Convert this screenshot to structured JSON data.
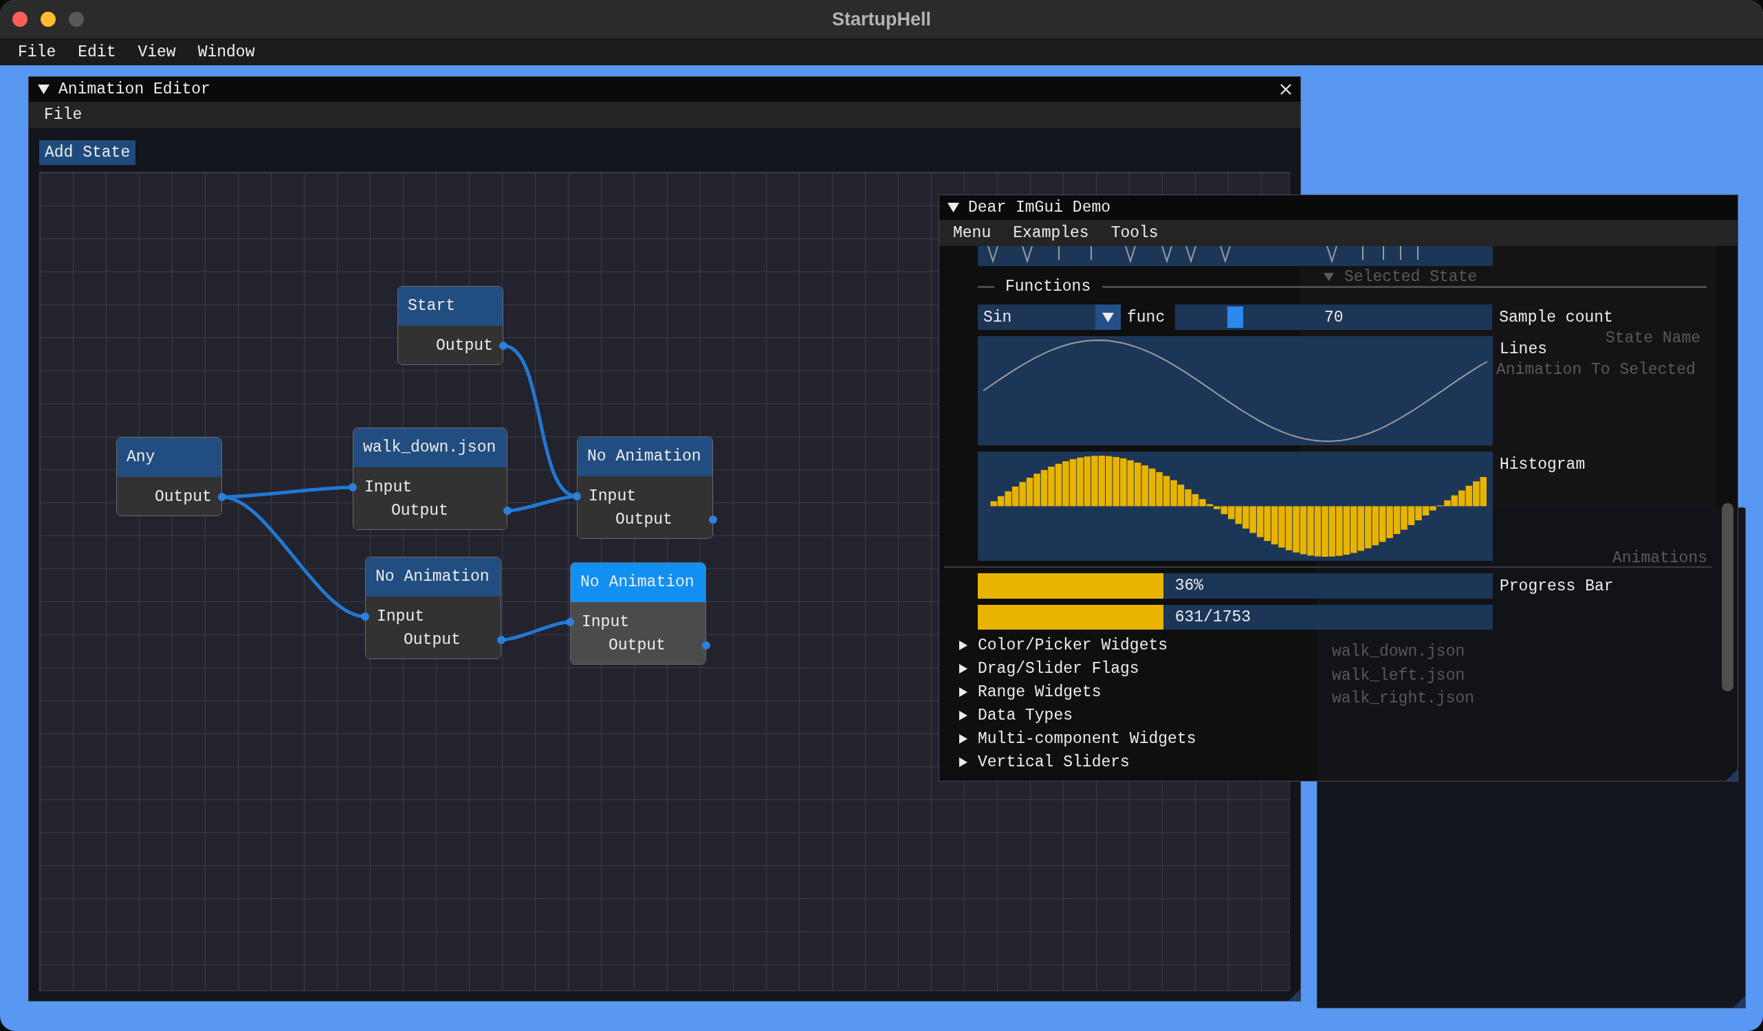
{
  "app": {
    "title": "StartupHell",
    "window_controls": [
      {
        "kind": "close",
        "disabled": false
      },
      {
        "kind": "minimize",
        "disabled": false
      },
      {
        "kind": "zoom",
        "disabled": true
      }
    ],
    "menu": [
      "File",
      "Edit",
      "View",
      "Window"
    ]
  },
  "animation_editor": {
    "title": "Animation Editor",
    "collapsed": false,
    "menu": [
      "File"
    ],
    "add_button": "Add State",
    "nodes": [
      {
        "title": "Start",
        "selected": false,
        "pins": [
          {
            "kind": "output",
            "label": "Output"
          }
        ]
      },
      {
        "title": "Any",
        "selected": false,
        "pins": [
          {
            "kind": "output",
            "label": "Output"
          }
        ]
      },
      {
        "title": "walk_down.json",
        "selected": false,
        "pins": [
          {
            "kind": "input",
            "label": "Input"
          },
          {
            "kind": "output",
            "label": "Output"
          }
        ]
      },
      {
        "title": "No Animation",
        "selected": false,
        "pins": [
          {
            "kind": "input",
            "label": "Input"
          },
          {
            "kind": "output",
            "label": "Output"
          }
        ]
      },
      {
        "title": "No Animation",
        "selected": false,
        "pins": [
          {
            "kind": "input",
            "label": "Input"
          },
          {
            "kind": "output",
            "label": "Output"
          }
        ]
      },
      {
        "title": "No Animation",
        "selected": true,
        "pins": [
          {
            "kind": "input",
            "label": "Input"
          },
          {
            "kind": "output",
            "label": "Output"
          }
        ]
      }
    ]
  },
  "background_window": {
    "title": "Selected State",
    "collapsed": false,
    "field_label": "State Name",
    "action": "Animation To Selected",
    "list_header": "Animations",
    "list_items": [
      "walk_down.json",
      "walk_left.json",
      "walk_right.json"
    ]
  },
  "demo_window": {
    "title": "Dear ImGui Demo",
    "collapsed": false,
    "menu": [
      "Menu",
      "Examples",
      "Tools"
    ],
    "separator": "Functions",
    "combo": {
      "label": "func",
      "value": "Sin"
    },
    "slider": {
      "label": "Sample count",
      "value": "70",
      "level": 0.17
    },
    "plots": [
      {
        "kind": "lines",
        "label": "Lines"
      },
      {
        "kind": "histogram",
        "label": "Histogram"
      }
    ],
    "progress_bars": [
      {
        "label": "Progress Bar",
        "overlay": "36%",
        "level": 0.36
      },
      {
        "overlay": "631/1753",
        "level": 0.36
      }
    ],
    "tree_nodes": [
      {
        "label": "Color/Picker Widgets",
        "expanded": false
      },
      {
        "label": "Drag/Slider Flags",
        "expanded": false
      },
      {
        "label": "Range Widgets",
        "expanded": false
      },
      {
        "label": "Data Types",
        "expanded": false
      },
      {
        "label": "Multi-component Widgets",
        "expanded": false
      },
      {
        "label": "Vertical Sliders",
        "expanded": false
      }
    ]
  }
}
